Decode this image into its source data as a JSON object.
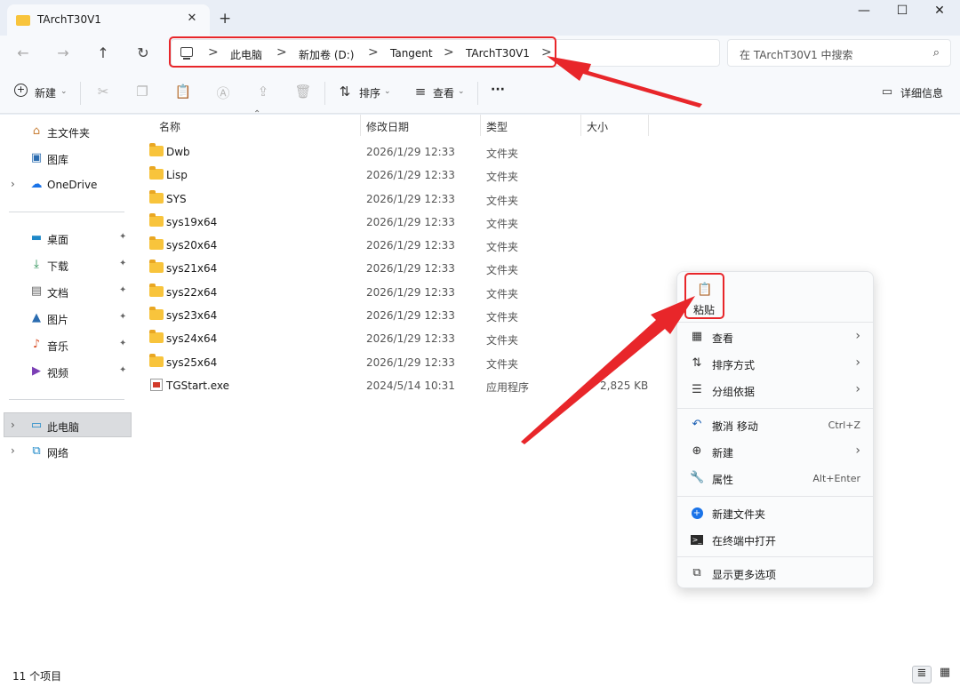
{
  "window": {
    "tab_title": "TArchT30V1",
    "close_tab": "✕",
    "new_tab": "+",
    "minimize": "—",
    "maximize": "☐",
    "close": "✕"
  },
  "nav": {
    "back": "←",
    "forward": "→",
    "up": "↑",
    "refresh": "↻"
  },
  "address": {
    "crumbs": [
      "此电脑",
      "新加卷 (D:)",
      "Tangent",
      "TArchT30V1"
    ],
    "separator": ">"
  },
  "search": {
    "placeholder": "在 TArchT30V1 中搜索"
  },
  "toolbar": {
    "new_label": "新建",
    "sort_label": "排序",
    "view_label": "查看",
    "more_label": "···",
    "details_label": "详细信息"
  },
  "sidebar": {
    "items": [
      {
        "label": "主文件夹",
        "icon": "home-icon"
      },
      {
        "label": "图库",
        "icon": "gallery-icon"
      },
      {
        "label": "OneDrive",
        "icon": "cloud-icon"
      },
      {
        "label": "桌面",
        "icon": "desktop-icon"
      },
      {
        "label": "下载",
        "icon": "download-icon"
      },
      {
        "label": "文档",
        "icon": "document-icon"
      },
      {
        "label": "图片",
        "icon": "picture-icon"
      },
      {
        "label": "音乐",
        "icon": "music-icon"
      },
      {
        "label": "视频",
        "icon": "video-icon"
      },
      {
        "label": "此电脑",
        "icon": "computer-icon"
      },
      {
        "label": "网络",
        "icon": "network-icon"
      }
    ]
  },
  "columns": {
    "name": "名称",
    "date": "修改日期",
    "type": "类型",
    "size": "大小"
  },
  "files": [
    {
      "name": "Dwb",
      "date": "2026/1/29 12:33",
      "type": "文件夹",
      "size": ""
    },
    {
      "name": "Lisp",
      "date": "2026/1/29 12:33",
      "type": "文件夹",
      "size": ""
    },
    {
      "name": "SYS",
      "date": "2026/1/29 12:33",
      "type": "文件夹",
      "size": ""
    },
    {
      "name": "sys19x64",
      "date": "2026/1/29 12:33",
      "type": "文件夹",
      "size": ""
    },
    {
      "name": "sys20x64",
      "date": "2026/1/29 12:33",
      "type": "文件夹",
      "size": ""
    },
    {
      "name": "sys21x64",
      "date": "2026/1/29 12:33",
      "type": "文件夹",
      "size": ""
    },
    {
      "name": "sys22x64",
      "date": "2026/1/29 12:33",
      "type": "文件夹",
      "size": ""
    },
    {
      "name": "sys23x64",
      "date": "2026/1/29 12:33",
      "type": "文件夹",
      "size": ""
    },
    {
      "name": "sys24x64",
      "date": "2026/1/29 12:33",
      "type": "文件夹",
      "size": ""
    },
    {
      "name": "sys25x64",
      "date": "2026/1/29 12:33",
      "type": "文件夹",
      "size": ""
    },
    {
      "name": "TGStart.exe",
      "date": "2024/5/14 10:31",
      "type": "应用程序",
      "size": "2,825 KB"
    }
  ],
  "context_menu": {
    "paste_label": "粘贴",
    "items": [
      {
        "label": "查看",
        "shortcut": "",
        "submenu": true,
        "icon": "grid-icon"
      },
      {
        "label": "排序方式",
        "shortcut": "",
        "submenu": true,
        "icon": "sort-icon"
      },
      {
        "label": "分组依据",
        "shortcut": "",
        "submenu": true,
        "icon": "group-icon"
      },
      {
        "label": "撤消 移动",
        "shortcut": "Ctrl+Z",
        "submenu": false,
        "icon": "undo-icon"
      },
      {
        "label": "新建",
        "shortcut": "",
        "submenu": true,
        "icon": "plus-circle-icon"
      },
      {
        "label": "属性",
        "shortcut": "Alt+Enter",
        "submenu": false,
        "icon": "wrench-icon"
      },
      {
        "label": "新建文件夹",
        "shortcut": "",
        "submenu": false,
        "icon": "new-folder-icon"
      },
      {
        "label": "在终端中打开",
        "shortcut": "",
        "submenu": false,
        "icon": "terminal-icon"
      },
      {
        "label": "显示更多选项",
        "shortcut": "",
        "submenu": false,
        "icon": "more-options-icon"
      }
    ]
  },
  "status": {
    "count_text": "11 个项目"
  },
  "colors": {
    "accent_red": "#e8262a",
    "folder_yellow": "#f8c43c",
    "window_bg": "#e9eef6"
  }
}
